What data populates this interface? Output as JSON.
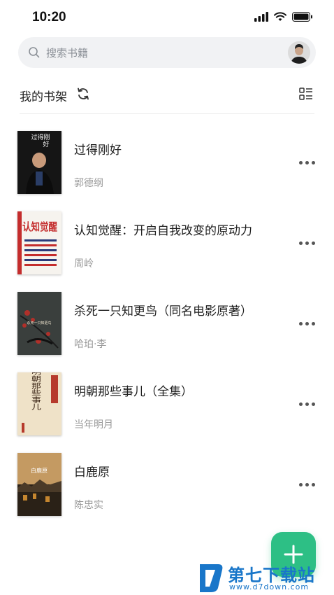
{
  "status_bar": {
    "time": "10:20"
  },
  "search": {
    "placeholder": "搜索书籍"
  },
  "shelf": {
    "title": "我的书架"
  },
  "books": [
    {
      "title": "过得刚好",
      "author": "郭德纲"
    },
    {
      "title": "认知觉醒：开启自我改变的原动力",
      "author": "周岭"
    },
    {
      "title": "杀死一只知更鸟（同名电影原著）",
      "author": "哈珀·李"
    },
    {
      "title": "明朝那些事儿（全集）",
      "author": "当年明月"
    },
    {
      "title": "白鹿原",
      "author": "陈忠实"
    }
  ],
  "covers": {
    "c1": {
      "line1": "过得刚",
      "line2": "好"
    },
    "c2": {
      "text": "认知觉醒"
    },
    "c3": {
      "line1": "杀死一只知更鸟"
    },
    "c4": {
      "text": "明朝那些事儿"
    },
    "c5": {
      "text": "白鹿原"
    }
  },
  "watermark": {
    "main": "第七下载站",
    "sub": "www.d7down.com"
  },
  "colors": {
    "accent": "#2dbf85",
    "watermark": "#1976c9"
  }
}
